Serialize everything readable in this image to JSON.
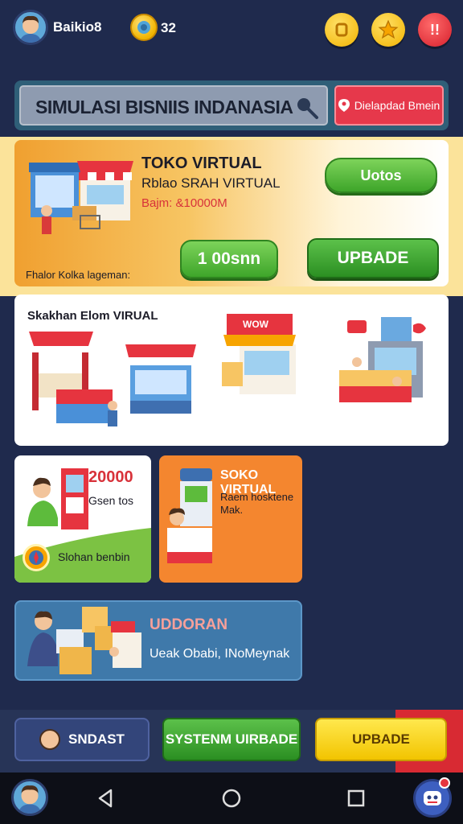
{
  "header": {
    "username": "Baikio8",
    "coin_count": "32",
    "notification_badge": "!!"
  },
  "search": {
    "title": "SIMULASI BISNIIS INDANASIA",
    "download_label": "Dielapdad Bmein"
  },
  "hero": {
    "title": "TOKO VIRTUAL",
    "subtitle": "Rblao SRAH VIRTUAL",
    "price": "Bajm: &10000M",
    "top_button": "Uotos",
    "amount_button": "1 00snn",
    "upgrade_button": "UPBADE",
    "footer_text": "Fhalor Kolka lageman:"
  },
  "showcase": {
    "label": "Skakhan  Elom VIRUAL",
    "shop_sign": "WOW"
  },
  "card_a": {
    "value": "20000",
    "sub": "Gsen tos",
    "footer": "Slohan benbin"
  },
  "card_b": {
    "title": "SOKO VIRTUAL",
    "desc": "Raem hosktene Mak."
  },
  "card_c": {
    "title": "UDDORAN",
    "desc": "Ueak Obabi, INoMeynak"
  },
  "bottom": {
    "btn1": "SNDAST",
    "btn2": "SYSTENM UIRBADE",
    "btn3": "UPBADE"
  },
  "colors": {
    "background": "#1f2a4d",
    "accent_green": "#3ea52a",
    "accent_red": "#e6384b",
    "accent_yellow": "#f7d21c",
    "accent_orange": "#f4862f"
  }
}
